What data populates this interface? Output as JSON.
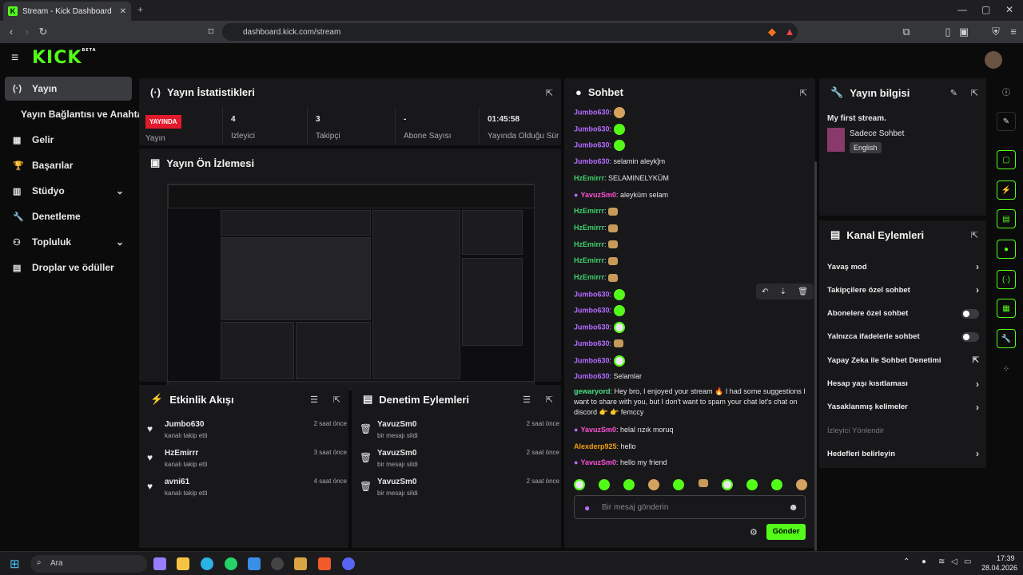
{
  "browser": {
    "tab_title": "Stream - Kick Dashboard",
    "url": "dashboard.kick.com/stream"
  },
  "app": {
    "logo": "KICK",
    "beta": "BETA"
  },
  "sidebar": {
    "items": [
      {
        "label": "Yayın",
        "icon": "broadcast-icon",
        "active": true
      },
      {
        "label": "Yayın Bağlantısı ve Anahtarı",
        "icon": ""
      },
      {
        "label": "Gelir",
        "icon": "table-icon"
      },
      {
        "label": "Başarılar",
        "icon": "trophy-icon"
      },
      {
        "label": "Stüdyo",
        "icon": "studio-icon",
        "chevron": true
      },
      {
        "label": "Denetleme",
        "icon": "wrench-icon"
      },
      {
        "label": "Topluluk",
        "icon": "community-icon",
        "chevron": true
      },
      {
        "label": "Droplar ve ödüller",
        "icon": "drops-icon"
      }
    ]
  },
  "stats": {
    "title": "Yayın İstatistikleri",
    "live": "YAYINDA",
    "live_label": "Yayın",
    "items": [
      {
        "value": "4",
        "label": "İzleyici"
      },
      {
        "value": "3",
        "label": "Takipçi"
      },
      {
        "value": "-",
        "label": "Abone Sayısı"
      },
      {
        "value": "01:45:58",
        "label": "Yayında Olduğu Süre"
      }
    ]
  },
  "preview": {
    "title": "Yayın Ön İzlemesi"
  },
  "activity": {
    "title": "Etkinlik Akışı",
    "items": [
      {
        "name": "Jumbo630",
        "sub": "kanalı takip etti",
        "time": "2 saat önce"
      },
      {
        "name": "HzEmirrr",
        "sub": "kanalı takip etti",
        "time": "3 saat önce"
      },
      {
        "name": "avni61",
        "sub": "kanalı takip etti",
        "time": "4 saat önce"
      }
    ]
  },
  "moderation": {
    "title": "Denetim Eylemleri",
    "items": [
      {
        "name": "YavuzSm0",
        "sub": "bir mesajı sildi",
        "time": "2 saat önce"
      },
      {
        "name": "YavuzSm0",
        "sub": "bir mesajı sildi",
        "time": "2 saat önce"
      },
      {
        "name": "YavuzSm0",
        "sub": "bir mesajı sildi",
        "time": "2 saat önce"
      }
    ]
  },
  "chat": {
    "title": "Sohbet",
    "placeholder": "Bir mesaj gönderin",
    "send": "Gönder",
    "lines": [
      {
        "user": "Jumbo630",
        "cls": "u-jumbo",
        "text": "",
        "emo": "f"
      },
      {
        "user": "Jumbo630",
        "cls": "u-jumbo",
        "text": "",
        "emo": "g"
      },
      {
        "user": "Jumbo630",
        "cls": "u-jumbo",
        "text": "",
        "emo": "g"
      },
      {
        "user": "Jumbo630",
        "cls": "u-jumbo",
        "text": "selamin aleyk]m"
      },
      {
        "user": "HzEmirrr",
        "cls": "u-hz",
        "text": "SELAMINELYKÜM"
      },
      {
        "user": "YavuzSm0",
        "cls": "u-yav",
        "text": "aleyküm selam",
        "mod": true
      },
      {
        "user": "HzEmirrr",
        "cls": "u-hz",
        "text": "",
        "emo": "b"
      },
      {
        "user": "HzEmirrr",
        "cls": "u-hz",
        "text": "",
        "emo": "b"
      },
      {
        "user": "HzEmirrr",
        "cls": "u-hz",
        "text": "",
        "emo": "b"
      },
      {
        "user": "HzEmirrr",
        "cls": "u-hz",
        "text": "",
        "emo": "b"
      },
      {
        "user": "HzEmirrr",
        "cls": "u-hz",
        "text": "",
        "emo": "b"
      },
      {
        "user": "Jumbo630",
        "cls": "u-jumbo",
        "text": "",
        "emo": "g"
      },
      {
        "user": "Jumbo630",
        "cls": "u-jumbo",
        "text": "",
        "emo": "g"
      },
      {
        "user": "Jumbo630",
        "cls": "u-jumbo",
        "text": "",
        "emo": "w"
      },
      {
        "user": "Jumbo630",
        "cls": "u-jumbo",
        "text": "",
        "emo": "b"
      },
      {
        "user": "Jumbo630",
        "cls": "u-jumbo",
        "text": "",
        "emo": "w"
      },
      {
        "user": "Jumbo630",
        "cls": "u-jumbo",
        "text": "Selamlar"
      }
    ],
    "long": {
      "user": "gewaryord",
      "text": "Hey bro, I enjoyed your stream 🔥 I had some suggestions I want to share with you, but I don't want to spam your chat let's chat on discord 👉 👉 femccy"
    },
    "tail": [
      {
        "user": "YavuzSm0",
        "cls": "u-yav",
        "text": "helal rızık moruq",
        "mod": true
      },
      {
        "user": "Alexderp925",
        "cls": "u-alex",
        "text": "hello"
      },
      {
        "user": "YavuzSm0",
        "cls": "u-yav",
        "text": "hello my friend",
        "mod": true
      }
    ]
  },
  "info": {
    "title": "Yayın bilgisi",
    "stream_title": "My first stream.",
    "category": "Sadece Sohbet",
    "language": "English"
  },
  "channel": {
    "title": "Kanal Eylemleri",
    "items": [
      {
        "label": "Yavaş mod",
        "type": "arrow"
      },
      {
        "label": "Takipçilere özel sohbet",
        "type": "arrow"
      },
      {
        "label": "Abonelere özel sohbet",
        "type": "toggle"
      },
      {
        "label": "Yalnızca ifadelerle sohbet",
        "type": "toggle"
      },
      {
        "label": "Yapay Zeka ile Sohbet Denetimi",
        "type": "ext"
      },
      {
        "label": "Hesap yaşı kısıtlaması",
        "type": "arrow"
      },
      {
        "label": "Yasaklanmış kelimeler",
        "type": "arrow"
      },
      {
        "label": "İzleyici Yönlendir",
        "type": "disabled"
      },
      {
        "label": "Hedefleri belirleyin",
        "type": "arrow"
      }
    ]
  },
  "taskbar": {
    "search": "Ara",
    "time": "17:39",
    "date": "28.04.2026"
  }
}
